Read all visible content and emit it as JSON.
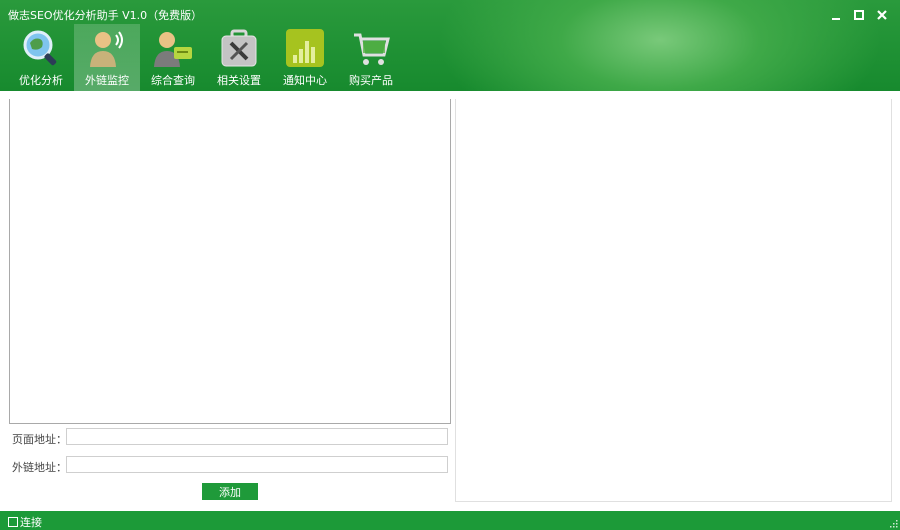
{
  "app": {
    "title": "做志SEO优化分析助手 V1.0（免费版）"
  },
  "window_controls": [
    "minimize-icon",
    "maximize-icon",
    "close-icon"
  ],
  "nav": {
    "items": [
      {
        "label": "优化分析",
        "icon": "magnifier-globe-icon"
      },
      {
        "label": "外链监控",
        "icon": "user-broadcast-icon"
      },
      {
        "label": "综合查询",
        "icon": "user-card-icon"
      },
      {
        "label": "相关设置",
        "icon": "toolbox-icon"
      },
      {
        "label": "通知中心",
        "icon": "equalizer-icon"
      },
      {
        "label": "购买产品",
        "icon": "shopping-cart-icon"
      }
    ],
    "active": "外链监控"
  },
  "form": {
    "page_url_label": "页面地址：",
    "page_url_value": "",
    "link_url_label": "外链地址：",
    "link_url_value": "",
    "add_label": "添加"
  },
  "status": {
    "text": "连接"
  },
  "colors": {
    "brand_green": "#1f9a3a",
    "title_green": "#2a9a3c"
  }
}
